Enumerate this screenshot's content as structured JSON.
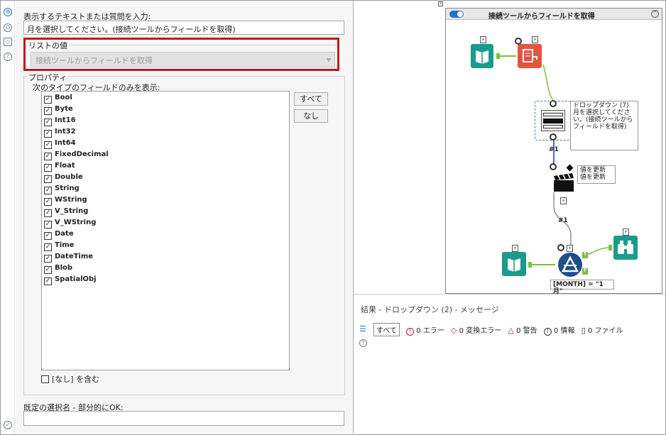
{
  "config": {
    "prompt_label": "表示するテキストまたは質問を入力:",
    "prompt_value": "月を選択してください。(接続ツールからフィールドを取得)",
    "list_group_title": "リストの値",
    "list_source_value": "接続ツールからフィールドを取得",
    "properties_title": "プロパティ",
    "field_types_label": "次のタイプのフィールドのみを表示:",
    "field_types": [
      "Bool",
      "Byte",
      "Int16",
      "Int32",
      "Int64",
      "FixedDecimal",
      "Float",
      "Double",
      "String",
      "WString",
      "V_String",
      "V_WString",
      "Date",
      "Time",
      "DateTime",
      "Blob",
      "SpatialObj"
    ],
    "all_button": "すべて",
    "none_button": "なし",
    "include_none_label": "[なし] を含む",
    "default_selection_label": "既定の選択名 - 部分的にOK:",
    "default_selection_value": ""
  },
  "canvas": {
    "container_title": "接続ツールからフィールドを取得",
    "dropdown_annotation": "ドロップダウン (7) 月を選択してください。(接続ツールからフィールドを取得)",
    "update_value_annotation": "値を更新 値を更新",
    "conn_label_1": "#1",
    "conn_label_2": "#1",
    "filter_annotation": "[MONTH] = \"1月\""
  },
  "results": {
    "title": "結果 - ドロップダウン (2) - メッセージ",
    "all_label": "すべて",
    "errors": "0 エラー",
    "conversion_errors": "0 変換エラー",
    "warnings": "0 警告",
    "info": "0 情報",
    "files": "0 ファイル"
  },
  "colors": {
    "highlight": "#c8151c",
    "teal": "#1a9c8a",
    "orange": "#e0563e",
    "blue": "#1a73d0",
    "navy": "#1e4e8c"
  }
}
